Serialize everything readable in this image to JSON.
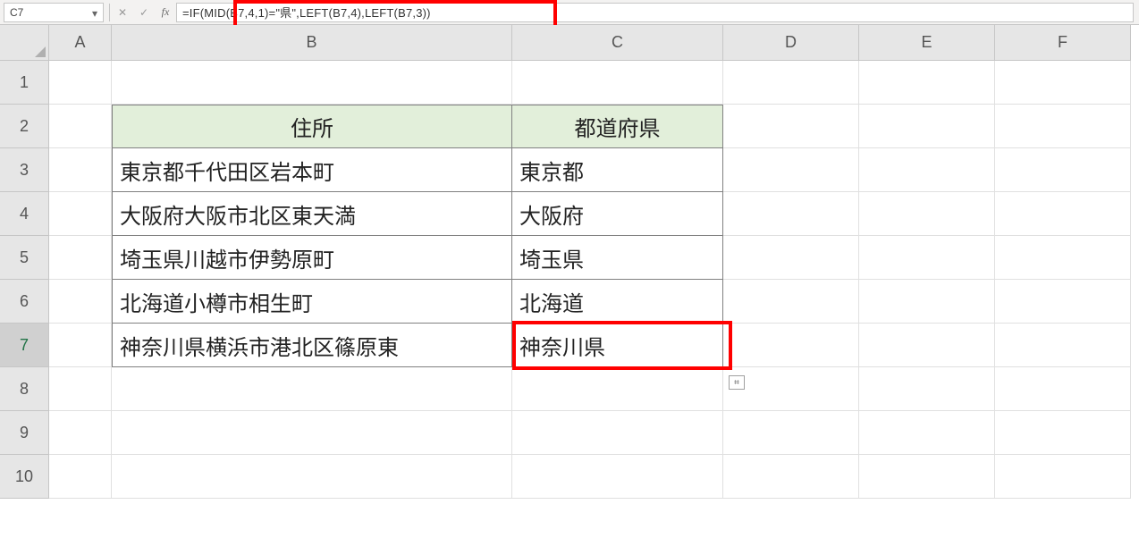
{
  "formula_bar": {
    "name_box_value": "C7",
    "fx_label": "fx",
    "formula": "=IF(MID(B7,4,1)=\"県\",LEFT(B7,4),LEFT(B7,3))"
  },
  "column_headers": [
    "A",
    "B",
    "C",
    "D",
    "E",
    "F"
  ],
  "row_headers": [
    "1",
    "2",
    "3",
    "4",
    "5",
    "6",
    "7",
    "8",
    "9",
    "10"
  ],
  "selected_row_header": "7",
  "table": {
    "header_b": "住所",
    "header_c": "都道府県",
    "rows": [
      {
        "b": "東京都千代田区岩本町",
        "c": "東京都"
      },
      {
        "b": "大阪府大阪市北区東天満",
        "c": "大阪府"
      },
      {
        "b": "埼玉県川越市伊勢原町",
        "c": "埼玉県"
      },
      {
        "b": "北海道小樽市相生町",
        "c": "北海道"
      },
      {
        "b": "神奈川県横浜市港北区篠原東",
        "c": "神奈川県"
      }
    ]
  },
  "icons": {
    "dropdown": "▾",
    "cancel": "✕",
    "enter": "✓",
    "autofill": "⌗"
  }
}
